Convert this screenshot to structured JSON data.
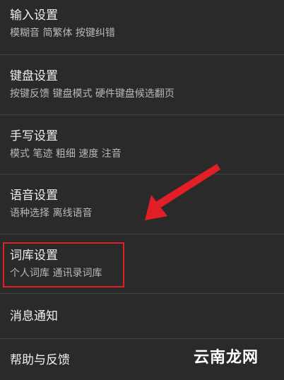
{
  "menu": {
    "items": [
      {
        "title": "输入设置",
        "subtitle": "模糊音 简繁体 按键纠错"
      },
      {
        "title": "键盘设置",
        "subtitle": "按键反馈 键盘模式 硬件键盘候选翻页"
      },
      {
        "title": "手写设置",
        "subtitle": "模式 笔迹 粗细 速度 注音"
      },
      {
        "title": "语音设置",
        "subtitle": "语种选择 离线语音"
      },
      {
        "title": "词库设置",
        "subtitle": "个人词库 通讯录词库"
      },
      {
        "title": "消息通知"
      },
      {
        "title": "帮助与反馈"
      }
    ]
  },
  "annotation": {
    "highlight_color": "#e21f26",
    "arrow_color": "#e21f26",
    "arrow_icon": "arrow-pointing-icon"
  },
  "watermark": {
    "text": "云南龙网"
  },
  "colors": {
    "background": "#2a2a2a",
    "divider": "#444444",
    "title": "#f0f0f0",
    "subtitle": "#b8b8b8"
  }
}
